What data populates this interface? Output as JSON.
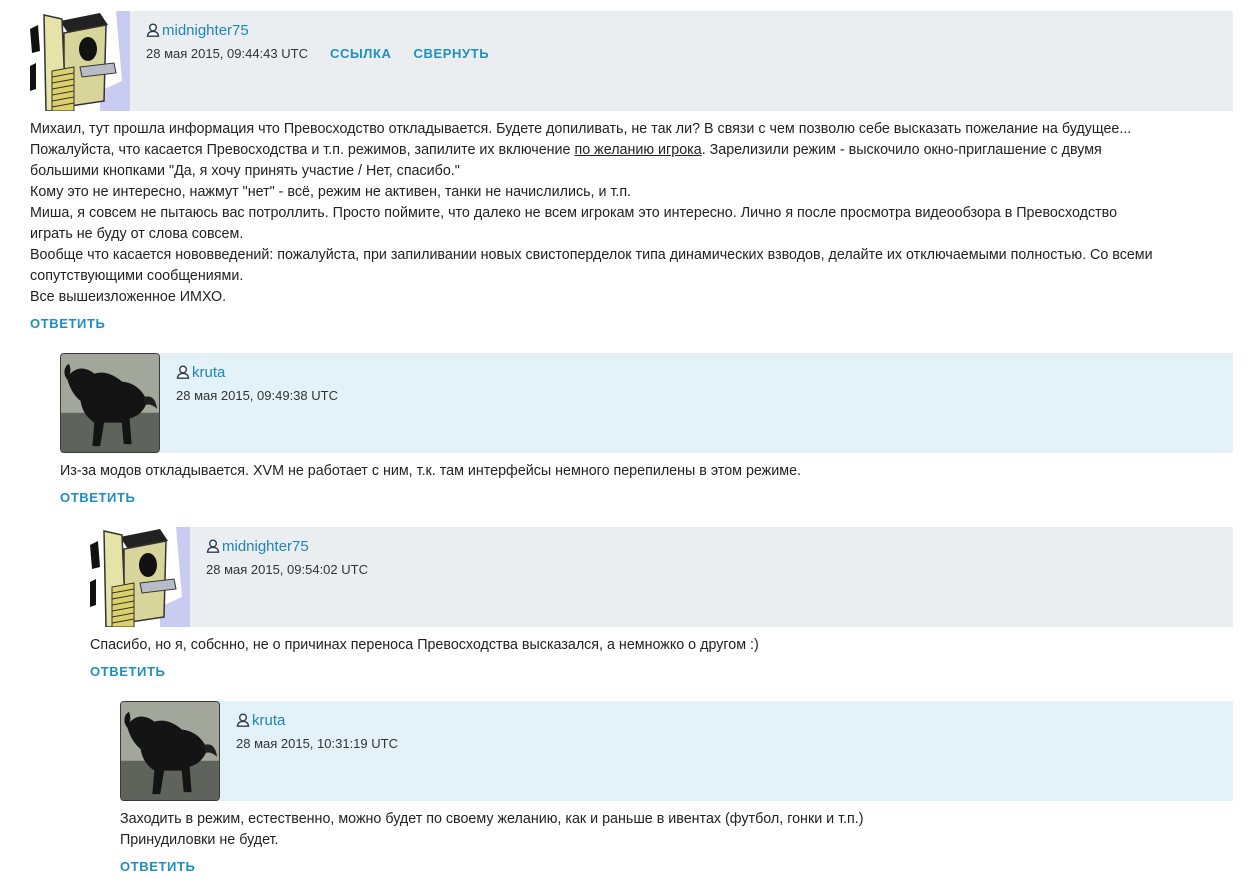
{
  "comments": [
    {
      "author": "midnighter75",
      "date": "28 мая 2015, 09:44:43 UTC",
      "link_label": "ССЫЛКА",
      "collapse_label": "СВЕРНУТЬ",
      "lines": [
        "Михаил, тут прошла информация что Превосходство откладывается. Будете допиливать, не так ли? В связи с чем позволю себе высказать пожелание на будущее...",
        "Пожалуйста, что касается Превосходства и т.п. режимов, запилите их включение",
        "по желанию игрока",
        ". Зарелизили режим - выскочило окно-приглашение с двумя",
        "большими кнопками \"Да, я хочу принять участие / Нет, спасибо.\"",
        "Кому это не интересно, нажмут \"нет\" - всё, режим не активен, танки не начислились, и т.п.",
        "Миша, я совсем не пытаюсь вас потроллить. Просто поймите, что далеко не всем игрокам это интересно. Лично я после просмотра видеообзора в Превосходство",
        "играть не буду от слова совсем.",
        "Вообще что касается нововведений: пожалуйста, при запиливании новых свистоперделок типа динамических взводов, делайте их отключаемыми полностью. Со всеми",
        "сопутствующими сообщениями.",
        "Все вышеизложенное ИМХО."
      ],
      "reply_label": "ОТВЕТИТЬ"
    },
    {
      "author": "kruta",
      "date": "28 мая 2015, 09:49:38 UTC",
      "lines": [
        "Из-за модов откладывается. XVM не работает с ним, т.к. там интерфейсы немного перепилены в этом режиме."
      ],
      "reply_label": "ОТВЕТИТЬ"
    },
    {
      "author": "midnighter75",
      "date": "28 мая 2015, 09:54:02 UTC",
      "lines": [
        "Спасибо, но я, собснно, не о причинах переноса Превосходства высказался, а немножко о другом :)"
      ],
      "reply_label": "ОТВЕТИТЬ"
    },
    {
      "author": "kruta",
      "date": "28 мая 2015, 10:31:19 UTC",
      "lines": [
        "Заходить в режим, естественно, можно будет по своему желанию, как и раньше в ивентах (футбол, гонки и т.п.)",
        "Принудиловки не будет."
      ],
      "reply_label": "ОТВЕТИТЬ"
    }
  ],
  "icons": {
    "user": "user-icon",
    "avatar_bird": "birdhouse-avatar",
    "avatar_wolf": "wolf-avatar"
  },
  "colors": {
    "link": "#1e85b9",
    "grey_header": "#ebeef1",
    "blue_header": "#e3f1f9"
  }
}
